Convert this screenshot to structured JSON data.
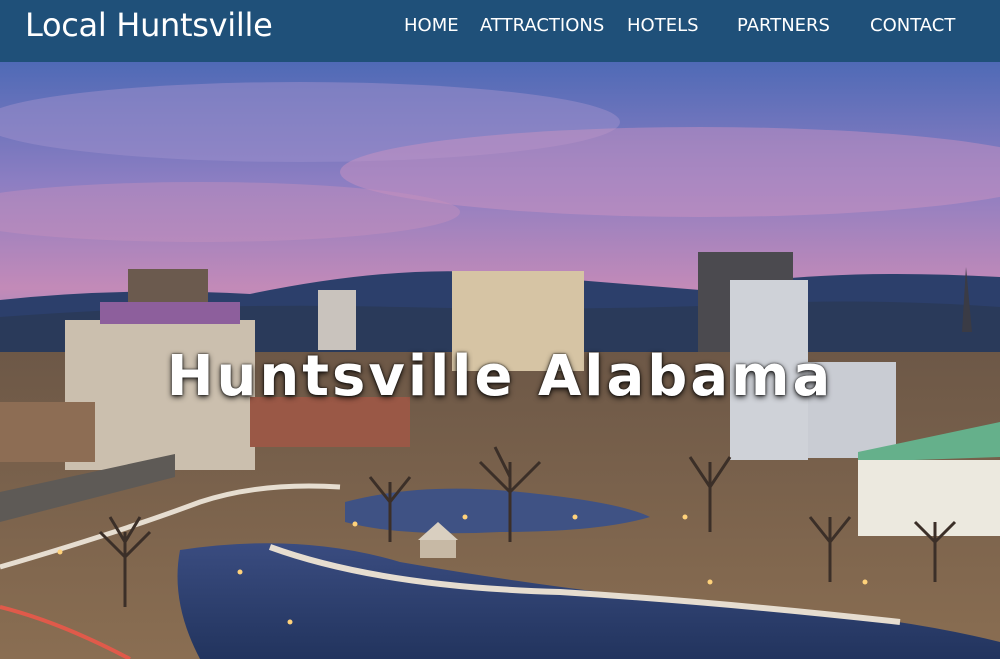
{
  "site": {
    "brand": "Local Huntsville"
  },
  "nav": {
    "items": [
      {
        "label": "HOME"
      },
      {
        "label": "ATTRACTIONS"
      },
      {
        "label": "HOTELS"
      },
      {
        "label": "PARTNERS"
      },
      {
        "label": "CONTACT"
      }
    ]
  },
  "hero": {
    "title": "Huntsville Alabama",
    "image_description_icon": "city-skyline-photo"
  },
  "colors": {
    "nav_background": "#1f5079",
    "nav_text": "#ffffff",
    "sky_purple": "#8c7ec2",
    "sky_pink": "#c38ab8"
  }
}
